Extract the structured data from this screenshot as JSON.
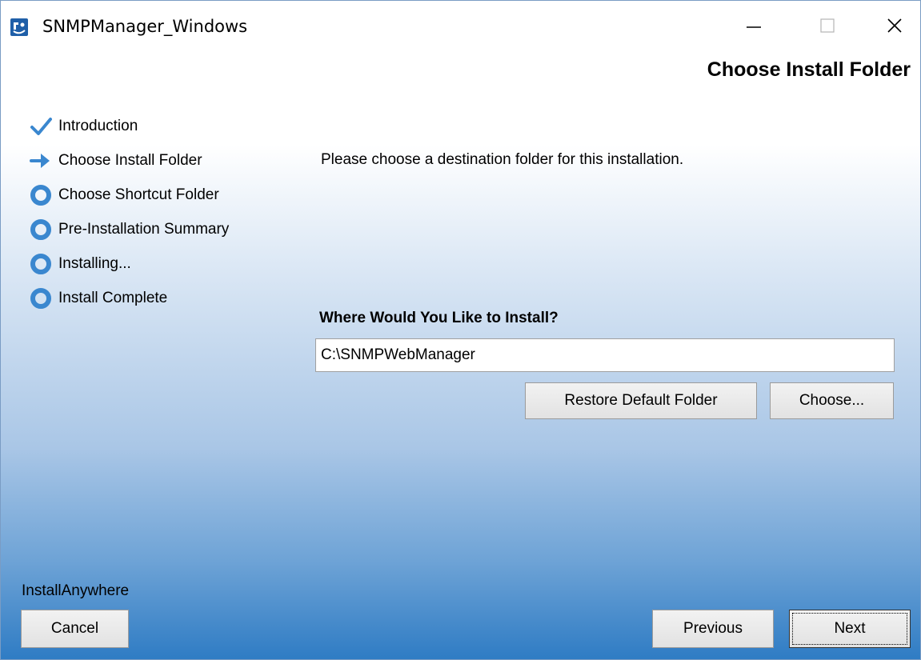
{
  "window": {
    "title": "SNMPManager_Windows",
    "icon": "app-logo-icon",
    "controls": {
      "minimize": "minimize-icon",
      "maximize": "maximize-icon",
      "close": "close-icon"
    }
  },
  "heading": "Choose Install Folder",
  "steps": [
    {
      "label": "Introduction",
      "state": "done",
      "icon": "checkmark-icon"
    },
    {
      "label": "Choose Install Folder",
      "state": "current",
      "icon": "arrow-right-icon"
    },
    {
      "label": "Choose Shortcut Folder",
      "state": "pending",
      "icon": "circle-icon"
    },
    {
      "label": "Pre-Installation Summary",
      "state": "pending",
      "icon": "circle-icon"
    },
    {
      "label": "Installing...",
      "state": "pending",
      "icon": "circle-icon"
    },
    {
      "label": "Install Complete",
      "state": "pending",
      "icon": "circle-icon"
    }
  ],
  "main": {
    "instruction": "Please choose a destination folder for this installation.",
    "where_label": "Where Would You Like to Install?",
    "path_value": "C:\\SNMPWebManager",
    "restore_label": "Restore Default Folder",
    "choose_label": "Choose..."
  },
  "footer": {
    "brand": "InstallAnywhere",
    "cancel_label": "Cancel",
    "previous_label": "Previous",
    "next_label": "Next"
  },
  "colors": {
    "accent": "#2f7cc4",
    "step_icon": "#3a87cf"
  }
}
